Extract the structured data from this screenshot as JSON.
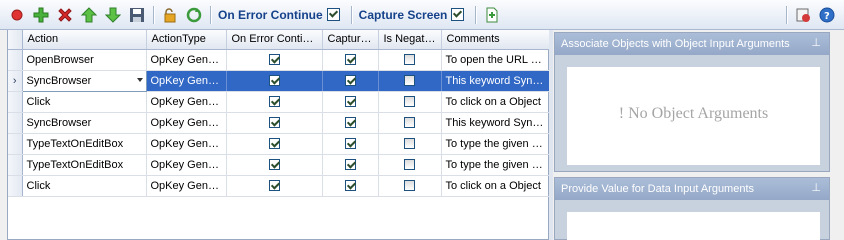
{
  "toolbar": {
    "on_error_label": "On Error Continue",
    "capture_label": "Capture Screen",
    "on_error_checked": true,
    "capture_checked": true,
    "icons": [
      "record-icon",
      "add-icon",
      "delete-icon",
      "move-up-icon",
      "move-down-icon",
      "save-icon",
      "unlock-icon",
      "refresh-icon",
      "add-step-icon",
      "report-icon",
      "help-icon"
    ]
  },
  "grid": {
    "columns": [
      "Action",
      "ActionType",
      "On Error Conti…",
      "Captur…",
      "Is Negat…",
      "Comments"
    ],
    "rows": [
      {
        "action": "OpenBrowser",
        "type": "OpKey Gene…",
        "on_error": true,
        "capture": true,
        "negate": false,
        "comment": "To open the URL o…"
      },
      {
        "action": "SyncBrowser",
        "type": "OpKey Gene…",
        "on_error": true,
        "capture": true,
        "negate": false,
        "comment": "This keyword Sync…",
        "selected": true
      },
      {
        "action": "Click",
        "type": "OpKey Gene…",
        "on_error": true,
        "capture": true,
        "negate": false,
        "comment": "To click on a Object"
      },
      {
        "action": "SyncBrowser",
        "type": "OpKey Gene…",
        "on_error": true,
        "capture": true,
        "negate": false,
        "comment": "This keyword Sync…"
      },
      {
        "action": "TypeTextOnEditBox",
        "type": "OpKey Gene…",
        "on_error": true,
        "capture": true,
        "negate": false,
        "comment": "To type the given …"
      },
      {
        "action": "TypeTextOnEditBox",
        "type": "OpKey Gene…",
        "on_error": true,
        "capture": true,
        "negate": false,
        "comment": "To type the given …"
      },
      {
        "action": "Click",
        "type": "OpKey Gene…",
        "on_error": true,
        "capture": true,
        "negate": false,
        "comment": "To click on a Object"
      }
    ]
  },
  "panels": {
    "objects_title": "Associate Objects with Object Input Arguments",
    "objects_empty": "! No Object Arguments",
    "data_title": "Provide Value for Data Input Arguments",
    "pin_glyph": "⊥"
  },
  "colors": {
    "accent": "#3168c5",
    "header_text": "#15428b"
  }
}
